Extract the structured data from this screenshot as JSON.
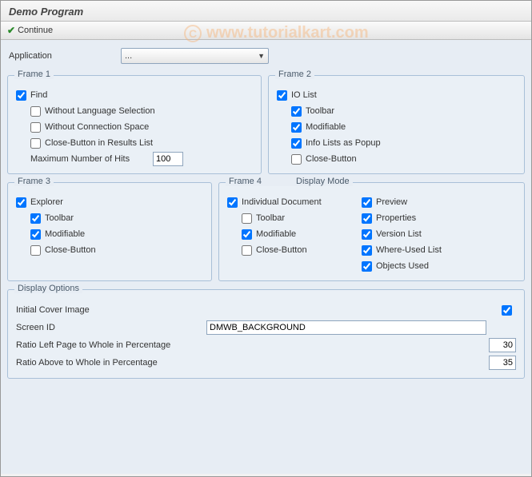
{
  "header": {
    "title": "Demo Program"
  },
  "toolbar": {
    "continue_label": "Continue"
  },
  "watermark": "www.tutorialkart.com",
  "application": {
    "label": "Application",
    "selected": "..."
  },
  "frame1": {
    "title": "Frame 1",
    "find": "Find",
    "without_lang": "Without Language Selection",
    "without_conn": "Without Connection Space",
    "close_btn_results": "Close-Button in Results List",
    "max_hits_label": "Maximum Number of Hits",
    "max_hits_value": "100"
  },
  "frame2": {
    "title": "Frame 2",
    "io_list": "IO List",
    "toolbar": "Toolbar",
    "modifiable": "Modifiable",
    "info_popup": "Info Lists as Popup",
    "close_btn": "Close-Button"
  },
  "frame3": {
    "title": "Frame 3",
    "explorer": "Explorer",
    "toolbar": "Toolbar",
    "modifiable": "Modifiable",
    "close_btn": "Close-Button"
  },
  "frame4": {
    "title": "Frame 4",
    "display_mode": "Display Mode",
    "individual_doc": "Individual Document",
    "toolbar": "Toolbar",
    "modifiable": "Modifiable",
    "close_btn": "Close-Button",
    "preview": "Preview",
    "properties": "Properties",
    "version_list": "Version List",
    "where_used": "Where-Used List",
    "objects_used": "Objects Used"
  },
  "display_options": {
    "title": "Display Options",
    "initial_cover": "Initial Cover Image",
    "screen_id_label": "Screen ID",
    "screen_id_value": "DMWB_BACKGROUND",
    "ratio_left_label": "Ratio Left Page to Whole in Percentage",
    "ratio_left_value": "30",
    "ratio_above_label": "Ratio Above to Whole in Percentage",
    "ratio_above_value": "35"
  }
}
